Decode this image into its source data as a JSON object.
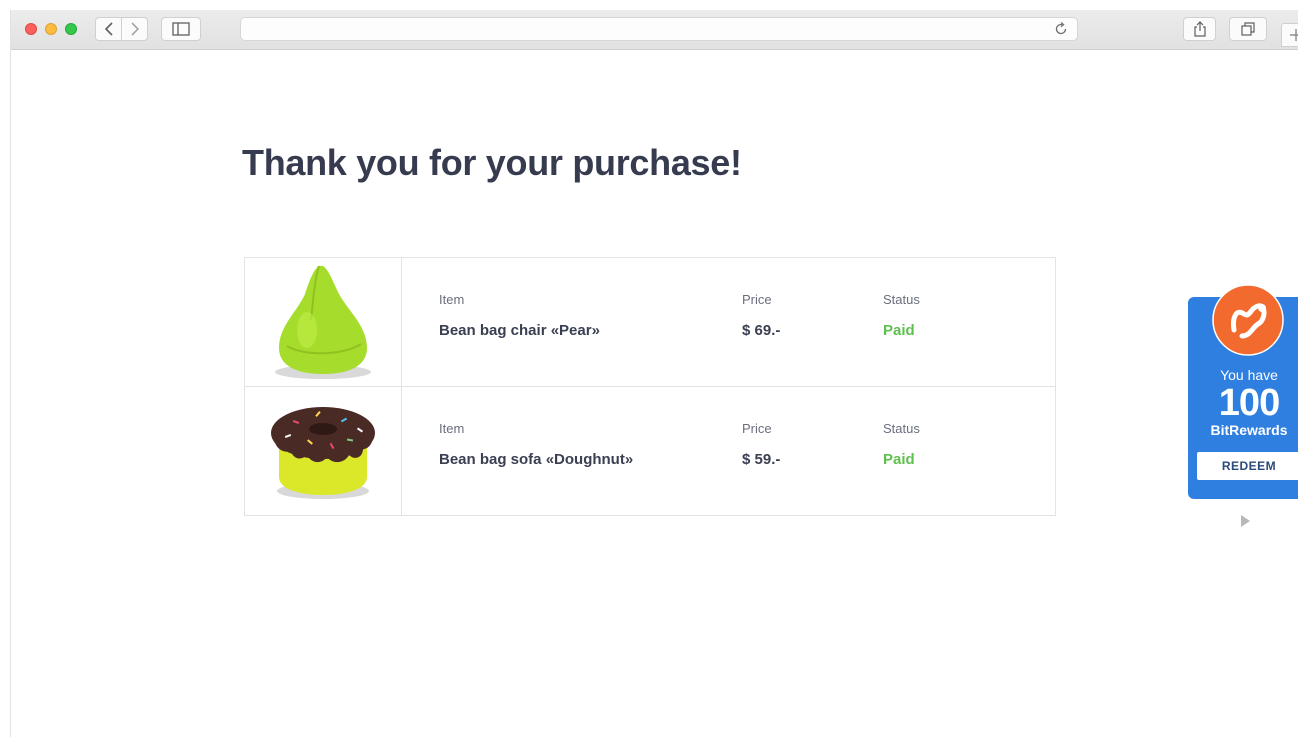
{
  "browser": {
    "icons": [
      "chevron-left-icon",
      "chevron-right-icon",
      "sidebar-icon",
      "reload-icon",
      "share-icon",
      "tabs-icon",
      "plus-icon"
    ],
    "address_value": ""
  },
  "page": {
    "title": "Thank you for your purchase!"
  },
  "order": {
    "items": [
      {
        "item_label": "Item",
        "item_name": "Bean bag chair «Pear»",
        "price_label": "Price",
        "price": "$ 69.-",
        "status_label": "Status",
        "status": "Paid"
      },
      {
        "item_label": "Item",
        "item_name": "Bean bag sofa «Doughnut»",
        "price_label": "Price",
        "price": "$ 59.-",
        "status_label": "Status",
        "status": "Paid"
      }
    ]
  },
  "rewards": {
    "you_have": "You have",
    "count": "100",
    "unit": "BitRewards",
    "redeem_label": "REDEEM",
    "accent": "#2f7fe0",
    "logo_color": "#f26a2e"
  },
  "colors": {
    "heading": "#363b4f",
    "paid": "#5fbf4f",
    "border": "#e3e3e3"
  }
}
